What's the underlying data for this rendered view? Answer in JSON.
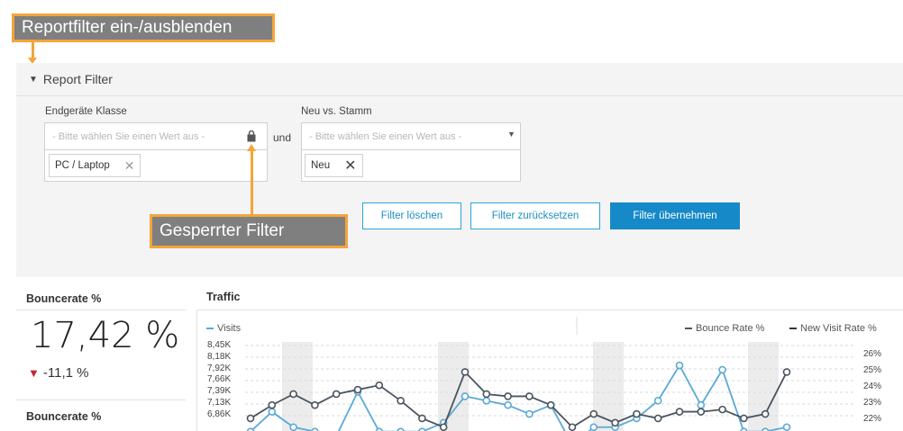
{
  "callouts": {
    "toggle_hint": "Reportfilter ein-/ausblenden",
    "locked_hint": "Gesperrter Filter"
  },
  "report_filter": {
    "title": "Report Filter",
    "filters": [
      {
        "label": "Endgeräte Klasse",
        "placeholder": "- Bitte wählen Sie einen Wert aus -",
        "locked": true,
        "selected": "PC / Laptop"
      },
      {
        "label": "Neu vs. Stamm",
        "placeholder": "- Bitte wählen Sie einen Wert aus -",
        "locked": false,
        "selected": "Neu"
      }
    ],
    "connector": "und",
    "buttons": {
      "clear": "Filter löschen",
      "reset": "Filter zurücksetzen",
      "apply": "Filter übernehmen"
    }
  },
  "kpi": {
    "title": "Bouncerate %",
    "value": "17,42 %",
    "delta": "-11,1 %",
    "delta_direction": "down",
    "second_title": "Bouncerate %"
  },
  "colors": {
    "accent": "#1689c8",
    "callout_border": "#f4a53a",
    "callout_bg": "#7f7f7f",
    "visits_line": "#5aa9d6",
    "rate_line": "#4a5560",
    "negative": "#c0272d"
  },
  "chart_data": {
    "type": "line",
    "title": "Traffic",
    "left_axis_ticks": [
      "8,45K",
      "8,18K",
      "7,92K",
      "7,66K",
      "7,39K",
      "7,13K",
      "6,86K"
    ],
    "right_axis_ticks": [
      "26%",
      "25%",
      "24%",
      "23%",
      "22%"
    ],
    "legend_left": "Visits",
    "legend_right": [
      "Bounce Rate %",
      "New Visit Rate %"
    ],
    "series": [
      {
        "name": "Visits",
        "values": [
          6.5,
          6.95,
          6.6,
          6.5,
          6.4,
          7.4,
          6.5,
          6.5,
          6.5,
          6.7,
          7.3,
          7.2,
          7.1,
          6.9,
          7.1,
          6.2,
          6.6,
          6.6,
          6.8,
          7.2,
          8.0,
          7.1,
          7.9,
          6.5,
          6.5,
          6.6
        ]
      },
      {
        "name": "Bounce Rate %",
        "values": [
          6.8,
          7.1,
          7.35,
          7.1,
          7.35,
          7.45,
          7.55,
          7.2,
          6.8,
          6.6,
          7.85,
          7.35,
          7.3,
          7.3,
          7.1,
          6.6,
          6.9,
          6.7,
          6.9,
          6.8,
          6.95,
          6.95,
          7.0,
          6.8,
          6.9,
          7.85
        ]
      }
    ]
  }
}
